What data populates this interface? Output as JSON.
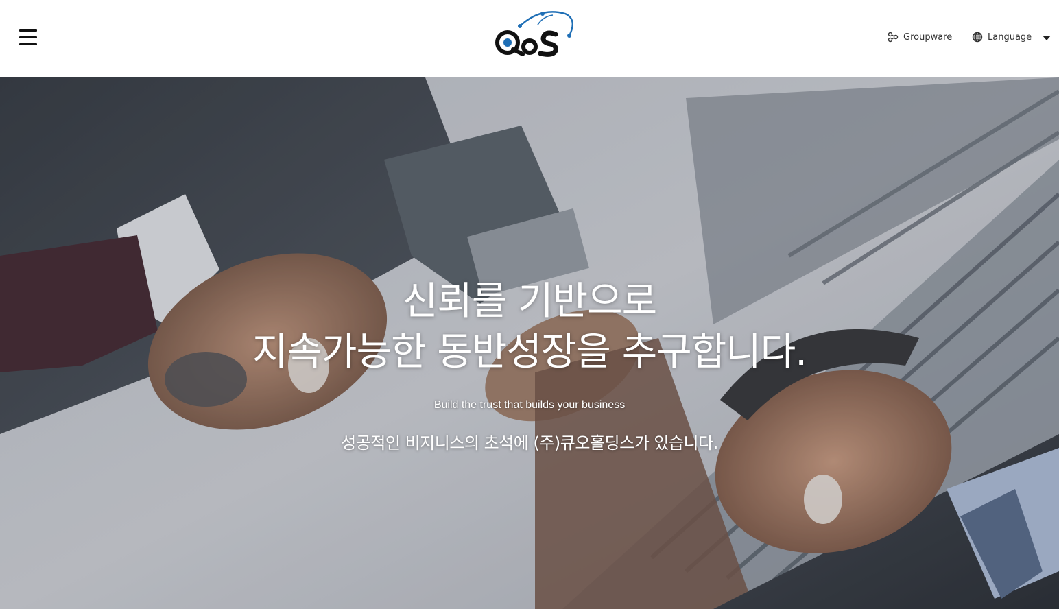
{
  "header": {
    "logo_text": "QoS",
    "links": {
      "groupware": "Groupware",
      "language": "Language"
    },
    "icons": {
      "menu": "hamburger-menu-icon",
      "groupware": "groupware-nodes-icon",
      "language": "globe-icon",
      "dropdown": "caret-down-icon"
    }
  },
  "hero": {
    "headline_line1": "신뢰를 기반으로",
    "headline_line2": "지속가능한 동반성장을 추구합니다.",
    "tagline_en": "Build the trust that builds your business",
    "tagline_ko": "성공적인 비지니스의 초석에 (주)큐오홀딩스가 있습니다."
  },
  "colors": {
    "logo_blue": "#1f6fb6",
    "logo_dark": "#111111",
    "text_white": "#ffffff"
  }
}
